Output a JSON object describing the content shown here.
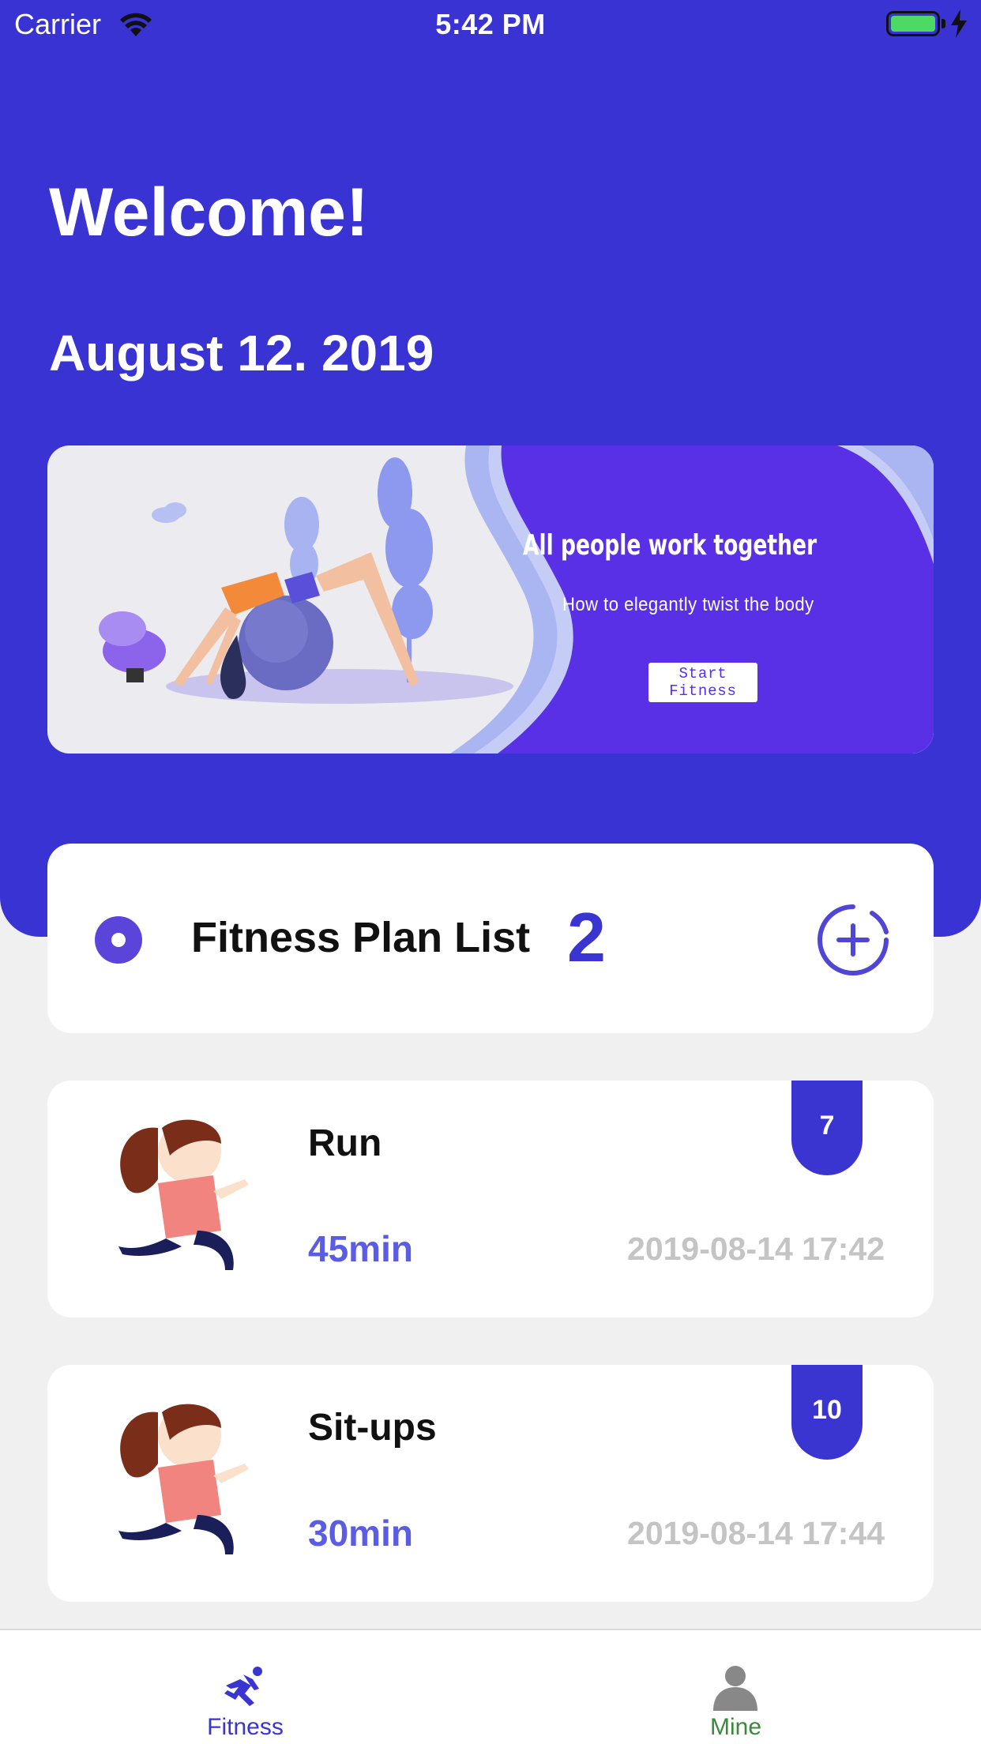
{
  "status_bar": {
    "carrier": "Carrier",
    "time": "5:42 PM"
  },
  "header": {
    "welcome": "Welcome!",
    "date": "August 12. 2019"
  },
  "banner": {
    "title": "All people work together",
    "subtitle": "How to elegantly twist the body",
    "button_label": "Start Fitness"
  },
  "plan_list": {
    "title": "Fitness Plan List",
    "count": "2"
  },
  "items": [
    {
      "name": "Run",
      "duration": "45min",
      "time": "2019-08-14 17:42",
      "badge": "7"
    },
    {
      "name": "Sit-ups",
      "duration": "30min",
      "time": "2019-08-14 17:44",
      "badge": "10"
    }
  ],
  "tabs": [
    {
      "label": "Fitness",
      "icon": "running-icon",
      "active": true
    },
    {
      "label": "Mine",
      "icon": "person-icon",
      "active": false
    }
  ],
  "colors": {
    "primary": "#3833d2",
    "accent_text": "#5a5ce4",
    "tab_mine": "#3a8a3a",
    "muted": "#c4c4c4"
  }
}
